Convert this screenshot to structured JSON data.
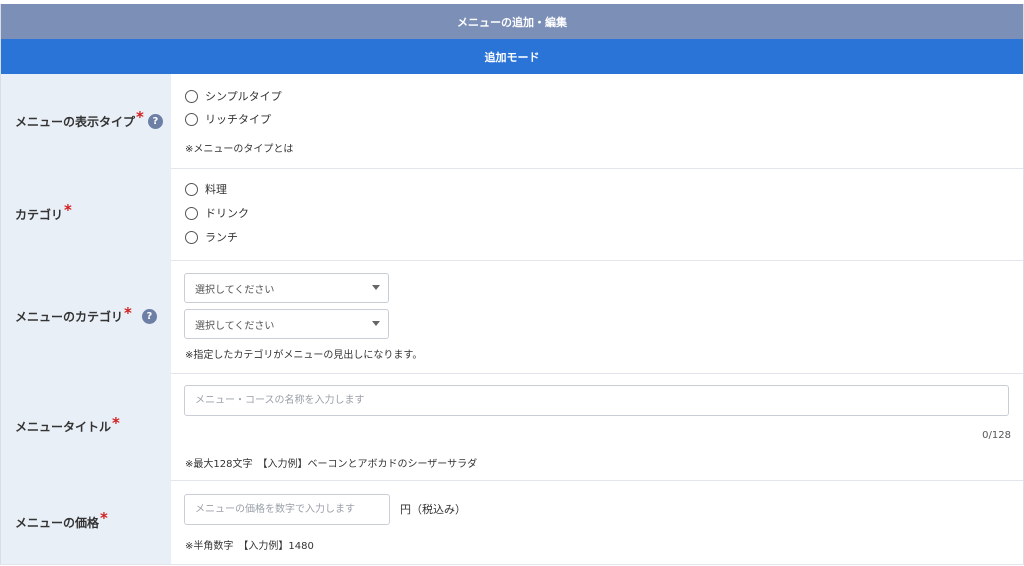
{
  "header": {
    "title": "メニューの追加・編集"
  },
  "mode": {
    "label": "追加モード"
  },
  "rows": {
    "display_type": {
      "label": "メニューの表示タイプ",
      "required_mark": "*",
      "help_icon": "question-circle-icon",
      "help_text": "?",
      "options": [
        "シンプルタイプ",
        "リッチタイプ"
      ],
      "note": "※メニューのタイプとは"
    },
    "category": {
      "label": "カテゴリ",
      "required_mark": "*",
      "options": [
        "料理",
        "ドリンク",
        "ランチ"
      ]
    },
    "menu_category": {
      "label": "メニューのカテゴリ",
      "required_mark": "*",
      "help_icon": "question-circle-icon",
      "help_text": "?",
      "select1": "選択してください",
      "select2": "選択してください",
      "note": "※指定したカテゴリがメニューの見出しになります。"
    },
    "title": {
      "label": "メニュータイトル",
      "required_mark": "*",
      "placeholder": "メニュー・コースの名称を入力します",
      "counter": "0/128",
      "note": "※最大128文字　【入力例】ベーコンとアボカドのシーザーサラダ"
    },
    "price": {
      "label": "メニューの価格",
      "required_mark": "*",
      "placeholder": "メニューの価格を数字で入力します",
      "unit": "円（税込み）",
      "note": "※半角数字　【入力例】1480"
    }
  },
  "colors": {
    "header_bg": "#7c8fb7",
    "mode_bg": "#2a74d8",
    "label_bg": "#e8eff7",
    "required": "#d21f1f"
  }
}
